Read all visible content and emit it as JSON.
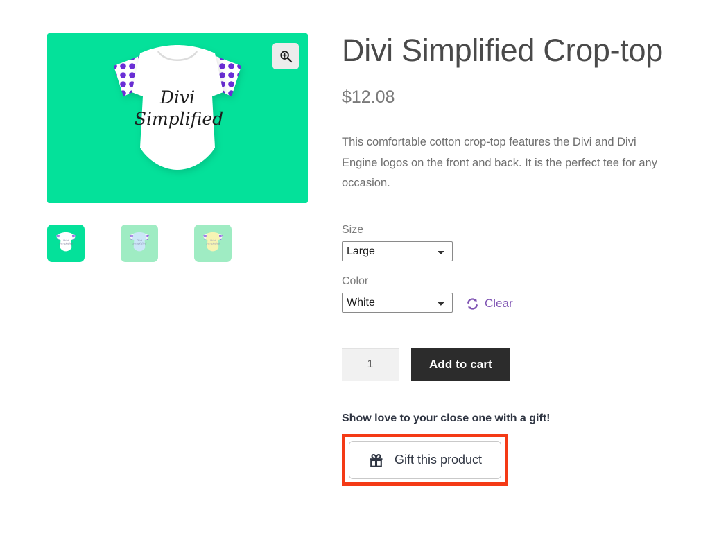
{
  "product": {
    "title": "Divi Simplified Crop-top",
    "price": "$12.08",
    "description": "This comfortable cotton crop-top features the Divi and Divi Engine logos on the front and back. It is the perfect tee for any occasion.",
    "shirt_graphic_line1": "Divi",
    "shirt_graphic_line2": "Simplified"
  },
  "gallery": {
    "zoom_icon": "magnifier-plus-icon",
    "main_image_bg": "#04e19a",
    "thumbnails": [
      {
        "name": "thumbnail-white-crop-top",
        "bg": "#04e19a",
        "shirt": "#ffffff",
        "selected": true
      },
      {
        "name": "thumbnail-blue-crop-top",
        "bg": "#9fecc3",
        "shirt": "#cbe6f7",
        "selected": false
      },
      {
        "name": "thumbnail-yellow-crop-top",
        "bg": "#9fecc3",
        "shirt": "#f6f4b4",
        "selected": false
      }
    ]
  },
  "variations": {
    "size": {
      "label": "Size",
      "value": "Large",
      "options": [
        "Large"
      ]
    },
    "color": {
      "label": "Color",
      "value": "White",
      "options": [
        "White"
      ]
    },
    "clear": {
      "label": "Clear",
      "icon": "refresh-icon",
      "color": "#7f54b3"
    }
  },
  "cart": {
    "quantity": "1",
    "quantity_placeholder": "1",
    "add_to_cart_label": "Add to cart",
    "button_color": "#2c2c2c"
  },
  "gift": {
    "tagline": "Show love to your close one with a gift!",
    "button_label": "Gift this product",
    "icon": "gift-icon",
    "highlight_color": "#f43a16"
  },
  "colors": {
    "brand_green": "#04e19a",
    "accent_purple": "#7f54b3",
    "polka_purple": "#6a2fd6",
    "text_dark": "#4a4a4a",
    "text_muted": "#7d7d7d"
  }
}
